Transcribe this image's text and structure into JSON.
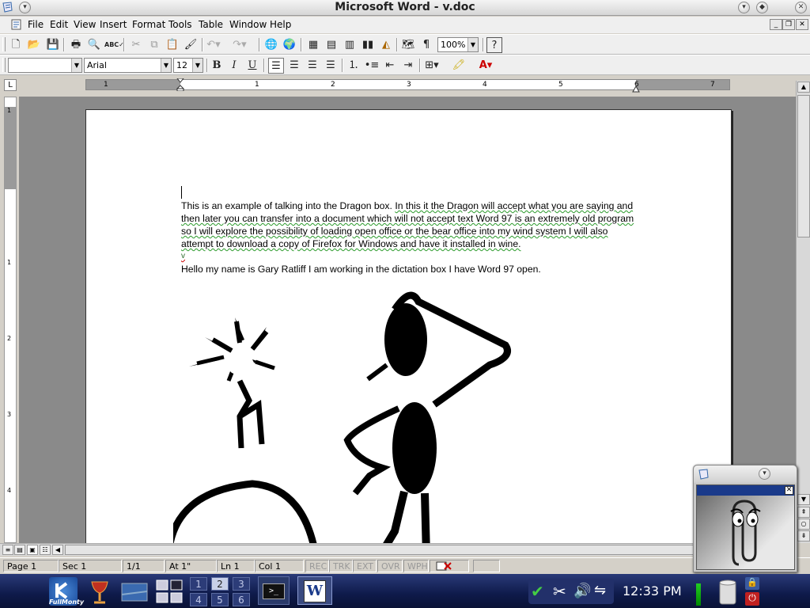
{
  "window": {
    "title": "Microsoft Word - v.doc"
  },
  "menu": [
    "File",
    "Edit",
    "View",
    "Insert",
    "Format",
    "Tools",
    "Table",
    "Window",
    "Help"
  ],
  "toolbar": {
    "zoom": "100%",
    "style": "",
    "font": "Arial",
    "size": "12"
  },
  "ruler": {
    "h_numbers": [
      "1",
      "1",
      "2",
      "3",
      "4",
      "5",
      "6",
      "7"
    ],
    "v_numbers": [
      "1",
      "1",
      "2",
      "3",
      "4"
    ]
  },
  "document": {
    "paragraph1_normal": "This is an example of talking into the Dragon box. ",
    "paragraph1_checked": "In this it the Dragon will accept what you are saying and then later you can transfer into a document which will not accept text Word 97 is an extremely old program so I will explore the possibility of loading open office or the bear office into my wind system I will also attempt to download a copy of Firefox for Windows and have it installed in wine.",
    "paragraph2": "v",
    "paragraph3": "Hello my name is Gary Ratliff I am working in the dictation box I have Word 97 open."
  },
  "status": {
    "page": "Page 1",
    "sec": "Sec 1",
    "count": "1/1",
    "at": "At 1\"",
    "ln": "Ln 1",
    "col": "Col 1",
    "rec": "REC",
    "trk": "TRK",
    "ext": "EXT",
    "ovr": "OVR",
    "wph": "WPH"
  },
  "taskbar": {
    "kde_label": "FullMonty",
    "desktops": [
      "1",
      "2",
      "3",
      "4",
      "5",
      "6"
    ],
    "active_desktop": "2",
    "clock": "12:33 PM",
    "terminal_prompt": ">_",
    "word_letter": "W"
  },
  "colors": {
    "page_bg": "#ffffff",
    "workspace": "#8a8a8a",
    "taskbar": "#1a2a60",
    "grammar_squiggle": "#2a9a2a"
  },
  "icons": [
    "app-icon",
    "minimize-icon",
    "maximize-icon",
    "close-icon",
    "new-icon",
    "open-icon",
    "save-icon",
    "print-icon",
    "preview-icon",
    "spell-icon",
    "cut-icon",
    "copy-icon",
    "paste-icon",
    "format-painter-icon",
    "undo-icon",
    "redo-icon",
    "hyperlink-icon",
    "web-toolbar-icon",
    "tables-borders-icon",
    "insert-table-icon",
    "insert-excel-icon",
    "columns-icon",
    "drawing-icon",
    "doc-map-icon",
    "show-hide-icon",
    "help-icon",
    "bold-icon",
    "italic-icon",
    "underline-icon",
    "align-left-icon",
    "center-icon",
    "align-right-icon",
    "justify-icon",
    "numbering-icon",
    "bullets-icon",
    "decrease-indent-icon",
    "increase-indent-icon",
    "borders-icon",
    "highlight-icon",
    "font-color-icon",
    "clippy-icon"
  ]
}
